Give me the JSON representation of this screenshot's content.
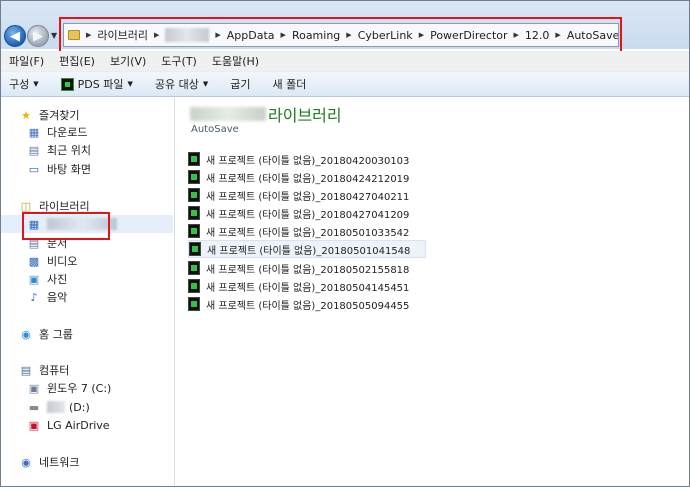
{
  "address_bar": {
    "crumbs": [
      "라이브러리",
      "",
      "AppData",
      "Roaming",
      "CyberLink",
      "PowerDirector",
      "12.0",
      "AutoSave"
    ]
  },
  "menu_bar": {
    "items": [
      "파일(F)",
      "편집(E)",
      "보기(V)",
      "도구(T)",
      "도움말(H)"
    ]
  },
  "command_bar": {
    "organize": "구성",
    "pds_file": "PDS 파일",
    "share": "공유 대상",
    "burn": "굽기",
    "new_folder": "새 폴더"
  },
  "nav": {
    "favorites": "즐겨찾기",
    "downloads": "다운로드",
    "recent": "최근 위치",
    "desktop": "바탕 화면",
    "libraries": "라이브러리",
    "documents": "문서",
    "videos": "비디오",
    "pictures": "사진",
    "music": "음악",
    "homegroup": "홈 그룹",
    "computer": "컴퓨터",
    "drive_c": "윈도우 7 (C:)",
    "drive_d": "(D:)",
    "lg_airdrive": "LG AirDrive",
    "network": "네트워크"
  },
  "content": {
    "library_title": "라이브러리",
    "subtitle": "AutoSave",
    "files": [
      "새 프로젝트 (타이틀 없음)_20180420030103",
      "새 프로젝트 (타이틀 없음)_20180424212019",
      "새 프로젝트 (타이틀 없음)_20180427040211",
      "새 프로젝트 (타이틀 없음)_20180427041209",
      "새 프로젝트 (타이틀 없음)_20180501033542",
      "새 프로젝트 (타이틀 없음)_20180501041548",
      "새 프로젝트 (타이틀 없음)_20180502155818",
      "새 프로젝트 (타이틀 없음)_20180504145451",
      "새 프로젝트 (타이틀 없음)_20180505094455"
    ]
  },
  "colors": {
    "highlight_red": "#e0141b",
    "library_title_green": "#1e7b1e",
    "nav_selected_bg": "#e5eefb"
  }
}
